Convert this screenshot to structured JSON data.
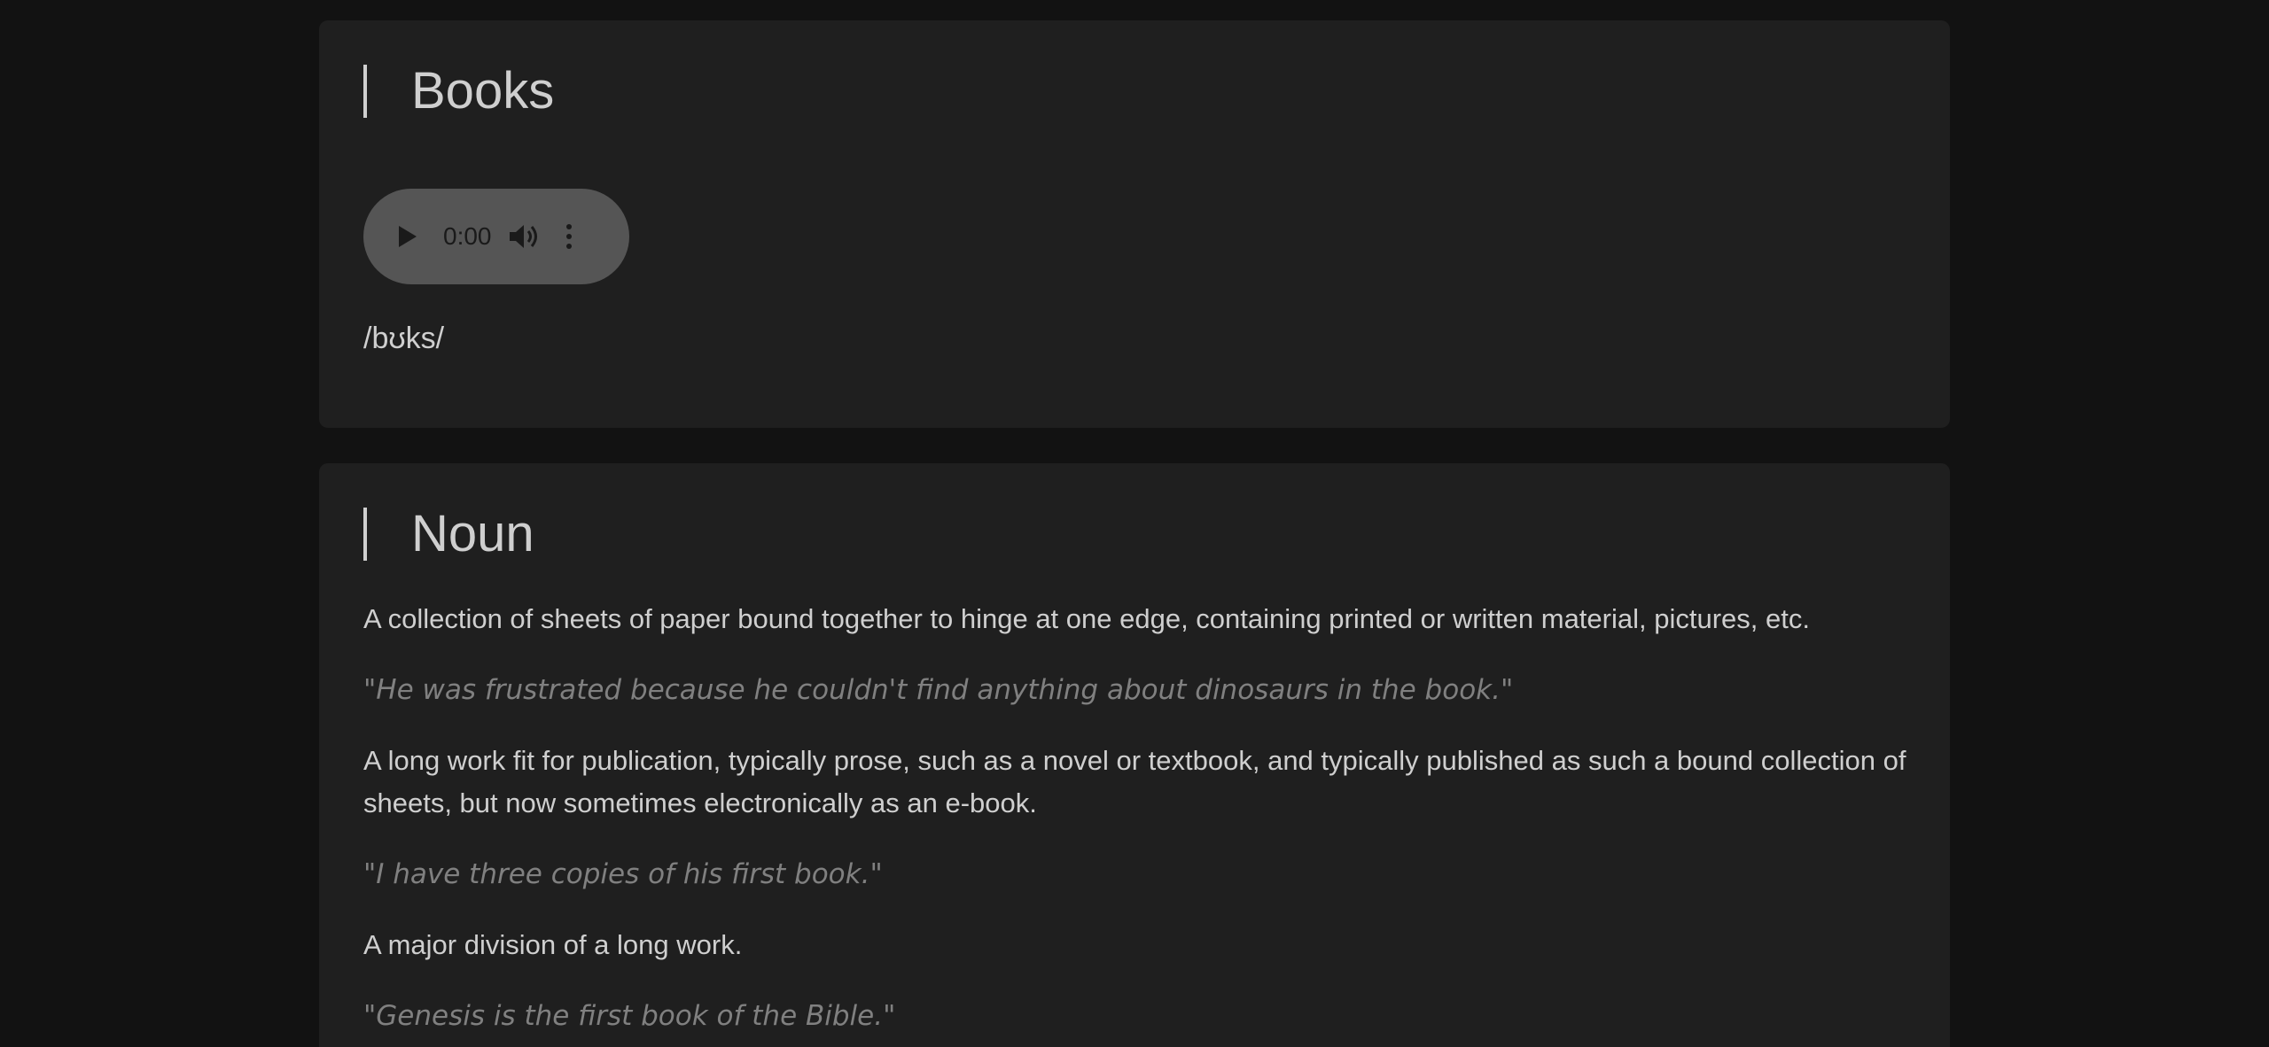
{
  "word": {
    "title": "Books",
    "audio": {
      "time": "0:00"
    },
    "phonetic": "/bʊks/"
  },
  "noun": {
    "title": "Noun",
    "entries": [
      {
        "definition": "A collection of sheets of paper bound together to hinge at one edge, containing printed or written material, pictures, etc.",
        "example": "\"He was frustrated because he couldn't find anything about dinosaurs in the book.\""
      },
      {
        "definition": "A long work fit for publication, typically prose, such as a novel or textbook, and typically published as such a bound collection of sheets, but now sometimes electronically as an e-book.",
        "example": "\"I have three copies of his first book.\""
      },
      {
        "definition": "A major division of a long work.",
        "example": "\"Genesis is the first book of the Bible.\""
      }
    ]
  }
}
